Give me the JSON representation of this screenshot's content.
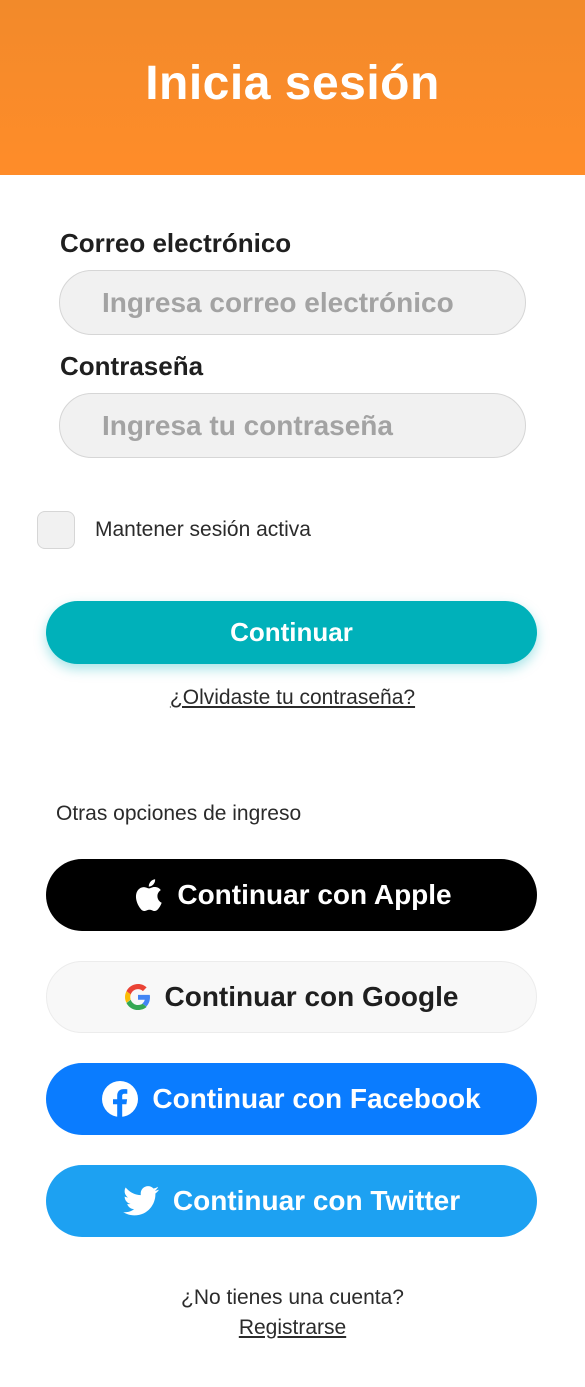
{
  "header": {
    "title": "Inicia sesión",
    "color": "#ff8c29"
  },
  "email": {
    "label": "Correo electrónico",
    "placeholder": "Ingresa correo electrónico",
    "value": ""
  },
  "password": {
    "label": "Contraseña",
    "placeholder": "Ingresa tu contraseña",
    "value": ""
  },
  "remember": {
    "label": "Mantener sesión activa",
    "checked": false
  },
  "continue_button": {
    "label": "Continuar",
    "color": "#00b1ba"
  },
  "forgot_link": "¿Olvidaste tu contraseña?",
  "other_options": {
    "label": "Otras opciones de ingreso",
    "buttons": [
      {
        "label": "Continuar con Apple",
        "icon": "apple-icon",
        "color": "#000000"
      },
      {
        "label": "Continuar con Google",
        "icon": "google-icon",
        "color": "#f8f8f8"
      },
      {
        "label": "Continuar con Facebook",
        "icon": "facebook-icon",
        "color": "#0a7cff"
      },
      {
        "label": "Continuar con Twitter",
        "icon": "twitter-icon",
        "color": "#1da1f2"
      }
    ]
  },
  "signup": {
    "prompt": "¿No tienes una cuenta?",
    "link": "Registrarse"
  }
}
